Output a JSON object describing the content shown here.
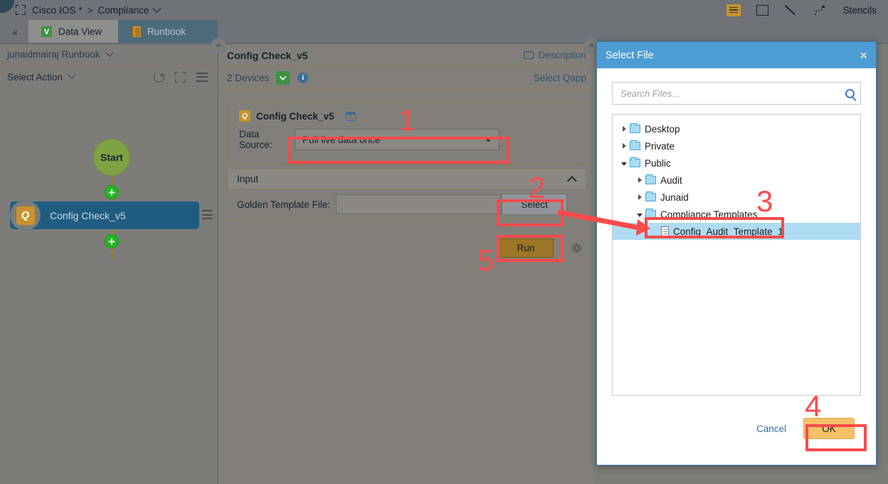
{
  "topbar": {
    "breadcrumb_root": "Cisco IOS *",
    "breadcrumb_sep": ">",
    "breadcrumb_current": "Compliance",
    "stencils_label": "Stencils",
    "icons": [
      "hamburger-icon",
      "square-icon",
      "pen-icon",
      "curve-icon"
    ],
    "expand_icon": "expand-arrows-icon"
  },
  "tabs": {
    "collapse_label": "«",
    "items": [
      {
        "label": "Data View",
        "icon": "v-logo-icon",
        "active": false
      },
      {
        "label": "Runbook",
        "icon": "notebook-icon",
        "active": true
      }
    ]
  },
  "left_panel": {
    "runbook_title": "junaidmairaj Runbook",
    "select_action_label": "Select Action",
    "icons": [
      "refresh-icon",
      "expand-icon",
      "menu-icon"
    ],
    "flow": {
      "start_label": "Start",
      "task_label": "Config Check_v5",
      "plus_label": "+"
    }
  },
  "center_panel": {
    "title": "Config Check_v5",
    "description_label": "Description",
    "devices_label": "2 Devices",
    "select_qapp_label": "Select Qapp",
    "card": {
      "title": "Config Check_v5",
      "data_source_label": "Data Source:",
      "data_source_value": "Pull live data once"
    },
    "input_section": {
      "header": "Input",
      "golden_template_label": "Golden Template File:",
      "golden_template_value": "",
      "select_button": "Select"
    },
    "run_button": "Run",
    "gear_icon": "gear-icon"
  },
  "pills": {
    "left": "»",
    "right": "»"
  },
  "dialog": {
    "title": "Select File",
    "close_label": "×",
    "search_placeholder": "Search Files...",
    "search_value": "",
    "tree": [
      {
        "label": "Desktop",
        "type": "folder",
        "depth": 0,
        "state": "closed",
        "selected": false
      },
      {
        "label": "Private",
        "type": "folder",
        "depth": 0,
        "state": "closed",
        "selected": false
      },
      {
        "label": "Public",
        "type": "folder",
        "depth": 0,
        "state": "open",
        "selected": false
      },
      {
        "label": "Audit",
        "type": "folder",
        "depth": 1,
        "state": "closed",
        "selected": false
      },
      {
        "label": "Junaid",
        "type": "folder",
        "depth": 1,
        "state": "closed",
        "selected": false
      },
      {
        "label": "Compliance Templates",
        "type": "folder",
        "depth": 1,
        "state": "open",
        "selected": false
      },
      {
        "label": "Config_Audit_Template_1",
        "type": "file",
        "depth": 2,
        "state": "none",
        "selected": true
      }
    ],
    "cancel_label": "Cancel",
    "ok_label": "OK"
  },
  "annotations": {
    "steps": [
      "1",
      "2",
      "3",
      "4",
      "5"
    ],
    "color": "#fc4a4a"
  },
  "colors": {
    "accent_blue": "#4d9dd4",
    "tab_active": "#4d6a7d",
    "node_task": "#1f5d80",
    "node_start": "#7fa343",
    "gold": "#c8922c",
    "ok_button": "#f5c06a",
    "run_button": "#9c7526",
    "annotation_red": "#fc4a4a",
    "selection_blue": "#aedcf2"
  }
}
